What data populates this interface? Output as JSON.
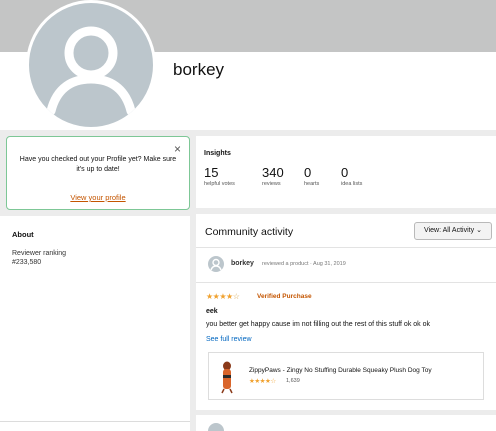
{
  "profile": {
    "name": "borkey"
  },
  "nudge": {
    "close": "×",
    "message": "Have you checked out your Profile yet? Make sure it's up to date!",
    "link": "View your profile"
  },
  "about": {
    "title": "About",
    "ranking_label": "Reviewer ranking",
    "ranking_value": "#233,580"
  },
  "insights": {
    "title": "Insights",
    "stats": [
      {
        "value": "15",
        "label": "helpful votes"
      },
      {
        "value": "340",
        "label": "reviews"
      },
      {
        "value": "0",
        "label": "hearts"
      },
      {
        "value": "0",
        "label": "idea lists"
      }
    ]
  },
  "activity": {
    "title": "Community activity",
    "view_button": "View: All Activity",
    "post": {
      "user": "borkey",
      "action": "reviewed a product · Aug 31, 2019",
      "rating": 4,
      "verified": "Verified Purchase",
      "review_title": "eek",
      "review_body": "you better get happy cause im not filling out the rest of this stuff ok ok ok",
      "see_full": "See full review",
      "product": {
        "name": "ZippyPaws - Zingy No Stuffing Durable Squeaky Plush Dog Toy",
        "rating": 4.5,
        "ratings_count": "1,639"
      }
    }
  },
  "colors": {
    "accent_orange": "#c45500",
    "link_blue": "#0066c0",
    "star": "#f0a12e",
    "nudge_border": "#7dc796"
  }
}
